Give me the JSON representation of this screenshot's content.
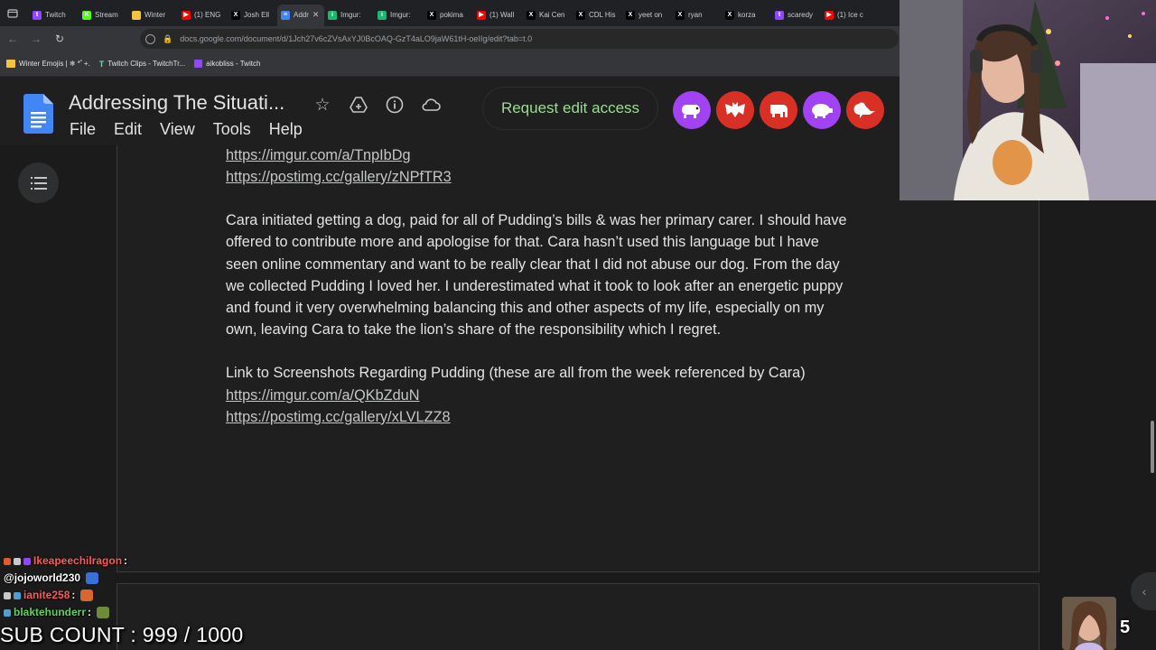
{
  "browser": {
    "tabs": [
      {
        "label": "Twitch",
        "color": "#9146ff",
        "glyph": "t"
      },
      {
        "label": "Stream",
        "color": "#53fc18",
        "glyph": "K"
      },
      {
        "label": "Winter",
        "color": "#f5c244",
        "glyph": ""
      },
      {
        "label": "(1) ENG",
        "color": "#ff0000",
        "glyph": "▶"
      },
      {
        "label": "Josh Ell",
        "color": "#000000",
        "glyph": "X"
      },
      {
        "label": "Addr",
        "color": "#4285f4",
        "glyph": "≡",
        "active": true
      },
      {
        "label": "Imgur:",
        "color": "#1bb76e",
        "glyph": "i"
      },
      {
        "label": "Imgur:",
        "color": "#1bb76e",
        "glyph": "i"
      },
      {
        "label": "pokima",
        "color": "#000000",
        "glyph": "X"
      },
      {
        "label": "(1) Wall",
        "color": "#ff0000",
        "glyph": "▶"
      },
      {
        "label": "Kai Cen",
        "color": "#000000",
        "glyph": "X"
      },
      {
        "label": "CDL His",
        "color": "#000000",
        "glyph": "X"
      },
      {
        "label": "yeet on",
        "color": "#000000",
        "glyph": "X"
      },
      {
        "label": "ryan",
        "color": "#000000",
        "glyph": "X"
      },
      {
        "label": "korza",
        "color": "#000000",
        "glyph": "X"
      },
      {
        "label": "scaredy",
        "color": "#9146ff",
        "glyph": "t"
      },
      {
        "label": "(1) Ice c",
        "color": "#ff0000",
        "glyph": "▶"
      }
    ],
    "tab_close_glyph": "✕",
    "url": "docs.google.com/document/d/1Jch27v6cZVsAxYJ0BcOAQ-GzT4aLO9jaW61tH-oeIIg/edit?tab=t.0",
    "bookmarks": [
      {
        "label": "Winter Emojis | ❄ *ﾟ+.",
        "type": "folder"
      },
      {
        "label": "Twitch Clips - TwitchTr...",
        "type": "clips"
      },
      {
        "label": "aikobliss - Twitch",
        "type": "twitch"
      }
    ]
  },
  "docs": {
    "title": "Addressing The Situati...",
    "menu": [
      "File",
      "Edit",
      "View",
      "Tools",
      "Help"
    ],
    "request_edit_label": "Request edit access",
    "avatar_colors": [
      "#a142f4",
      "#d93025",
      "#d93025",
      "#a142f4",
      "#d93025"
    ],
    "content": {
      "link1": "https://imgur.com/a/TnpIbDg",
      "link2": "https://postimg.cc/gallery/zNPfTR3",
      "paragraph_lines": [
        "Cara initiated getting a dog, paid for all of Pudding’s bills & was her primary carer. I should have",
        "offered to contribute more and apologise for that. Cara hasn’t used this language but I have",
        "seen online commentary and want to be really clear that I did not abuse our dog. From the day",
        "we collected Pudding I loved her. I underestimated what it took to look after an energetic puppy",
        "and found it very overwhelming balancing this and other aspects of my life, especially on my",
        "own, leaving Cara to take the lion’s share of the responsibility which I regret."
      ],
      "screenshots_heading": "Link to Screenshots Regarding Pudding (these are all from the week referenced by Cara)",
      "link3": "https://imgur.com/a/QKbZduN",
      "link4": "https://postimg.cc/gallery/xLVLZZ8"
    }
  },
  "stream_overlay": {
    "chat": [
      {
        "user": "Ikeapeechilragon",
        "text": ":",
        "color": "#ff5a5a"
      },
      {
        "user": "@jojoworld230",
        "text": "",
        "color": "#ffffff"
      },
      {
        "user": "ianite258",
        "text": ":",
        "color": "#ff5a5a"
      },
      {
        "user": "blaktehunderr",
        "text": ":",
        "color": "#5ad45a"
      }
    ],
    "sub_count": "SUB COUNT : 999 / 1000",
    "sub_number": "5"
  }
}
